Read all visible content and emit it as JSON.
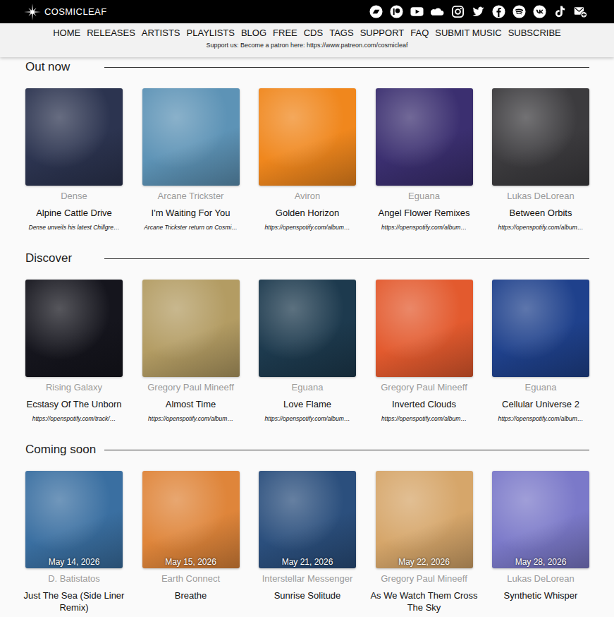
{
  "brand": "COSMICLEAF",
  "social": [
    {
      "kind": "bandcamp"
    },
    {
      "kind": "patreon"
    },
    {
      "kind": "youtube"
    },
    {
      "kind": "soundcloud"
    },
    {
      "kind": "instagram"
    },
    {
      "kind": "twitter"
    },
    {
      "kind": "facebook"
    },
    {
      "kind": "spotify"
    },
    {
      "kind": "vk"
    },
    {
      "kind": "tiktok"
    },
    {
      "kind": "mail"
    }
  ],
  "menu": [
    "HOME",
    "RELEASES",
    "ARTISTS",
    "PLAYLISTS",
    "BLOG",
    "FREE",
    "CDS",
    "TAGS",
    "SUPPORT",
    "FAQ",
    "SUBMIT MUSIC",
    "SUBSCRIBE"
  ],
  "support": "Support us: Become a patron here: https://www.patreon.com/cosmicleaf",
  "sections": [
    {
      "title": "Out now",
      "kind": "release",
      "items": [
        {
          "artist": "Dense",
          "title": "Alpine Cattle Drive",
          "note": "Dense unveils his latest Chillgre…",
          "color": "#2c3450"
        },
        {
          "artist": "Arcane Trickster",
          "title": "I'm Waiting For You",
          "note": "Arcane Trickster return on Cosmi…",
          "color": "#5d93b6"
        },
        {
          "artist": "Aviron",
          "title": "Golden Horizon",
          "note": "https://openspotify.com/album…",
          "color": "#f0871d"
        },
        {
          "artist": "Eguana",
          "title": "Angel Flower Remixes",
          "note": "https://openspotify.com/album…",
          "color": "#3b2f70"
        },
        {
          "artist": "Lukas DeLorean",
          "title": "Between Orbits",
          "note": "https://openspotify.com/album…",
          "color": "#3c3b3e"
        }
      ]
    },
    {
      "title": "Discover",
      "kind": "release",
      "items": [
        {
          "artist": "Rising Galaxy",
          "title": "Ecstasy Of The Unborn",
          "note": "https://openspotify.com/track/…",
          "color": "#15151d"
        },
        {
          "artist": "Gregory Paul Mineeff",
          "title": "Almost Time",
          "note": "https://openspotify.com/album…",
          "color": "#b39c63"
        },
        {
          "artist": "Eguana",
          "title": "Love Flame",
          "note": "https://openspotify.com/album…",
          "color": "#1d3a4e"
        },
        {
          "artist": "Gregory Paul Mineeff",
          "title": "Inverted Clouds",
          "note": "https://openspotify.com/album…",
          "color": "#e35a2e"
        },
        {
          "artist": "Eguana",
          "title": "Cellular Universe 2",
          "note": "https://openspotify.com/album…",
          "color": "#1f418c"
        }
      ]
    },
    {
      "title": "Coming soon",
      "kind": "upcoming",
      "items": [
        {
          "artist": "D. Batistatos",
          "title": "Just The Sea (Side Liner Remix)",
          "date": "May 14, 2026",
          "color": "#3a6fa1"
        },
        {
          "artist": "Earth Connect",
          "title": "Breathe",
          "date": "May 15, 2026",
          "color": "#df853a"
        },
        {
          "artist": "Interstellar Messenger",
          "title": "Sunrise Solitude",
          "date": "May 21, 2026",
          "color": "#2b4f7d"
        },
        {
          "artist": "Gregory Paul Mineeff",
          "title": "As We Watch Them Cross The Sky",
          "date": "May 22, 2026",
          "color": "#d6a66a"
        },
        {
          "artist": "Lukas DeLorean",
          "title": "Synthetic Whisper",
          "date": "May 28, 2026",
          "color": "#7b79c9"
        }
      ]
    }
  ]
}
